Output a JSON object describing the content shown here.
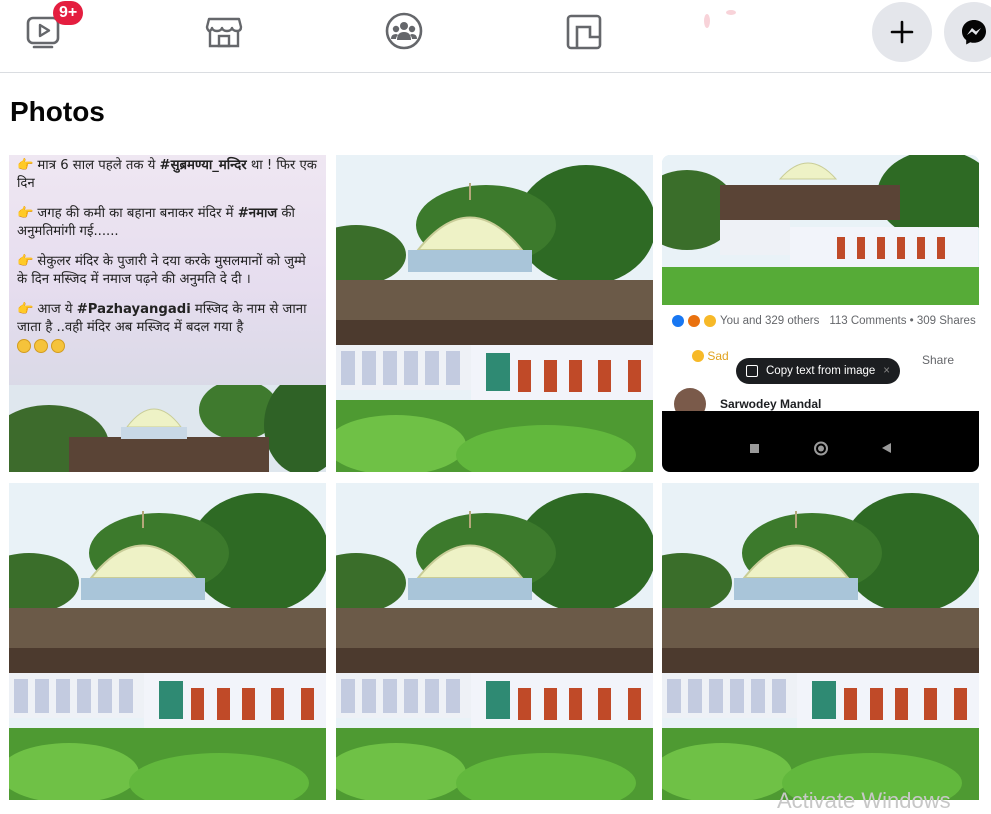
{
  "nav": {
    "watch_badge": "9+",
    "icons": [
      "watch-icon",
      "marketplace-icon",
      "groups-icon",
      "gaming-icon"
    ],
    "create_icon": "plus-icon",
    "messenger_icon": "messenger-icon"
  },
  "page": {
    "title": "Photos"
  },
  "photos": [
    {
      "kind": "text-post",
      "lines": [
        {
          "pre": "मात्र 6 साल पहले तक ये ",
          "tag": "#सुब्रमण्या_मन्दिर",
          "post": " था ! फिर एक दिन"
        },
        {
          "pre": "जगह की कमी का बहाना बनाकर मंदिर में ",
          "tag": "#नमाज",
          "post": " की अनुमतिमांगी गई......"
        },
        {
          "pre": "सेकुलर मंदिर के पुजारी ने दया करके मुसलमानों को जुम्मे के दिन मस्जिद में नमाज पढ़ने की अनुमति दे दी ।",
          "tag": "",
          "post": ""
        },
        {
          "pre": "आज ये ",
          "tag": "#Pazhayangadi",
          "post": " मस्जिद के नाम से जाना जाता है ..वही मंदिर अब मस्जिद में बदल गया है"
        }
      ]
    },
    {
      "kind": "mosque-photo"
    },
    {
      "kind": "phone-screenshot",
      "reactions": "You and 329 others",
      "comments": "113 Comments • 309 Shares",
      "sad_label": "Sad",
      "share_label": "Share",
      "copy_text": "Copy text from image",
      "poster": "Sarwodey Mandal"
    },
    {
      "kind": "mosque-photo"
    },
    {
      "kind": "mosque-photo"
    },
    {
      "kind": "mosque-photo"
    }
  ],
  "os_watermark": "Activate Windows",
  "colors": {
    "badge": "#e41e3f",
    "nav_circle": "#e4e6eb",
    "dome": "#f0f2c4",
    "wall": "#f2f4fa"
  }
}
